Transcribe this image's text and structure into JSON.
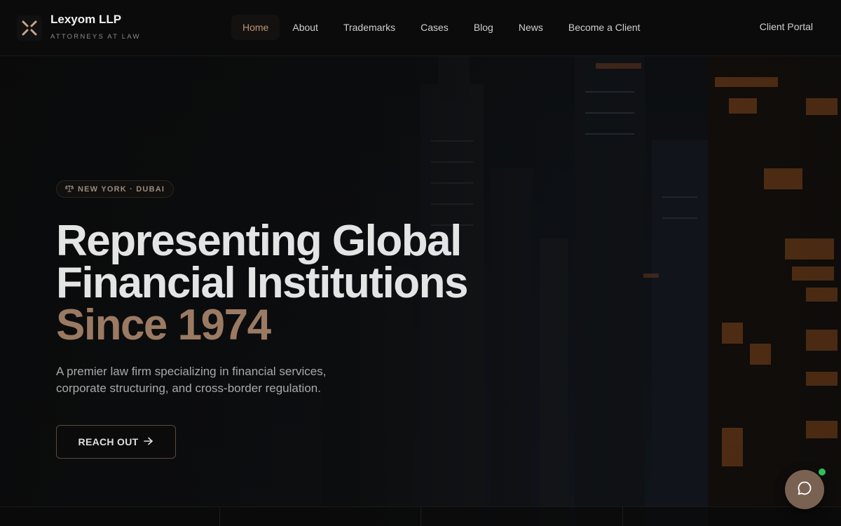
{
  "header": {
    "brand_name": "Lexyom LLP",
    "brand_tagline": "ATTORNEYS AT LAW",
    "nav": [
      {
        "label": "Home",
        "active": true
      },
      {
        "label": "About",
        "active": false
      },
      {
        "label": "Trademarks",
        "active": false
      },
      {
        "label": "Cases",
        "active": false
      },
      {
        "label": "Blog",
        "active": false
      },
      {
        "label": "News",
        "active": false
      },
      {
        "label": "Become a Client",
        "active": false
      }
    ],
    "portal_label": "Client Portal"
  },
  "hero": {
    "badge_icon": "scales-icon",
    "badge_text": "NEW YORK · DUBAI",
    "headline_line1": "Representing Global",
    "headline_line2": "Financial Institutions",
    "headline_accent": "Since 1974",
    "subtitle": "A premier law firm specializing in financial services, corporate structuring, and cross-border regulation.",
    "cta_label": "REACH OUT",
    "cta_icon": "arrow-right-icon"
  },
  "chat": {
    "icon": "chat-bubble-icon",
    "status": "online"
  },
  "colors": {
    "accent": "#9b7a63",
    "background": "#0a0a0a",
    "chat_button": "#7a6253",
    "online": "#2fbf5a"
  }
}
